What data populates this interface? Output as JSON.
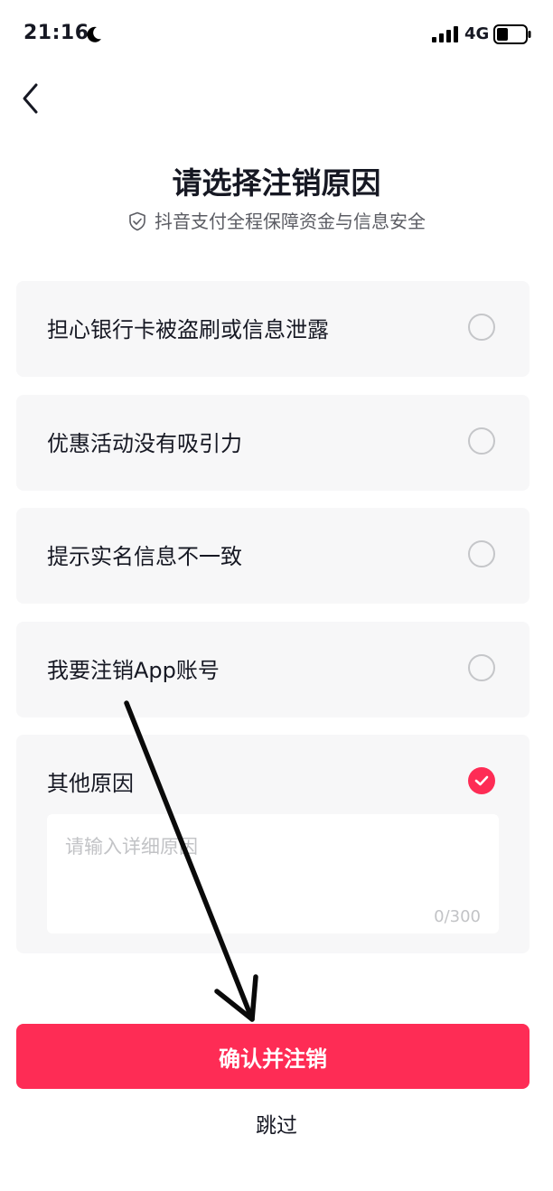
{
  "status_bar": {
    "time": "21:16",
    "network": "4G"
  },
  "header": {
    "back_icon": "chevron-left-icon"
  },
  "title": "请选择注销原因",
  "subtitle": "抖音支付全程保障资金与信息安全",
  "options": [
    {
      "label": "担心银行卡被盗刷或信息泄露",
      "checked": false
    },
    {
      "label": "优惠活动没有吸引力",
      "checked": false
    },
    {
      "label": "提示实名信息不一致",
      "checked": false
    },
    {
      "label": "我要注销App账号",
      "checked": false
    },
    {
      "label": "其他原因",
      "checked": true
    }
  ],
  "other_input": {
    "placeholder": "请输入详细原因",
    "value": "",
    "counter": "0/300"
  },
  "confirm_button": "确认并注销",
  "skip_link": "跳过",
  "colors": {
    "accent": "#fe2c55",
    "option_bg": "#f7f7f8",
    "text": "#161823",
    "subtle_text": "#5b5c63",
    "placeholder": "#c2c3c6"
  }
}
